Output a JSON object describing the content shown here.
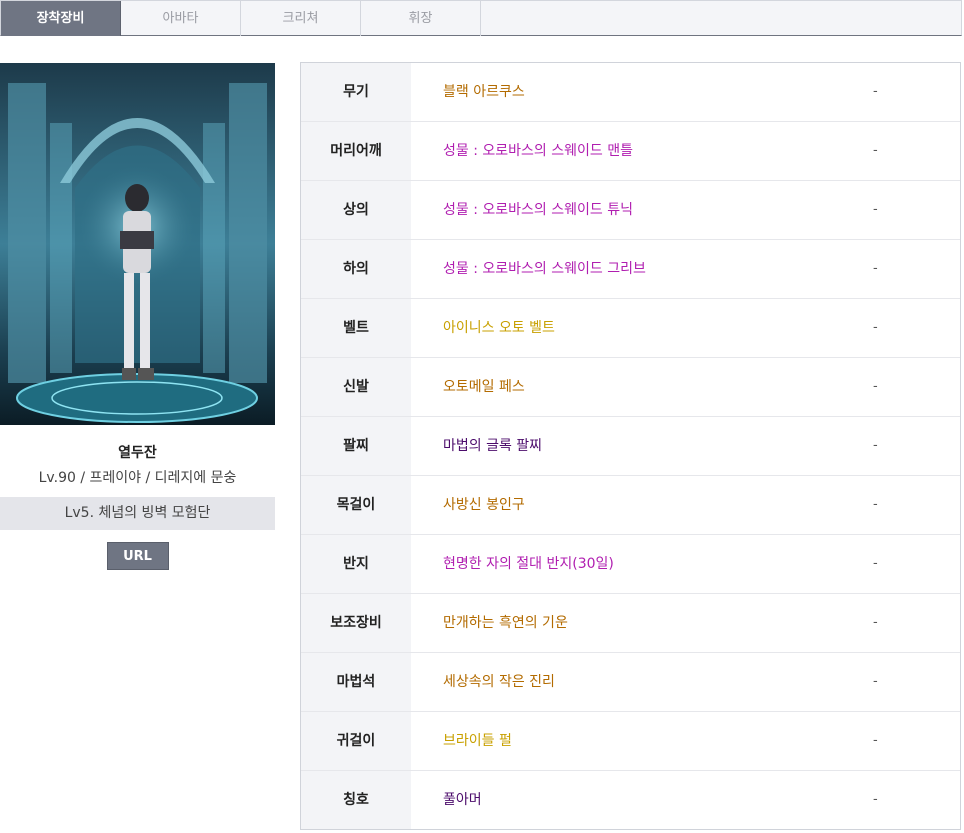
{
  "tabs": [
    {
      "label": "장착장비",
      "active": true
    },
    {
      "label": "아바타",
      "active": false
    },
    {
      "label": "크리쳐",
      "active": false
    },
    {
      "label": "휘장",
      "active": false
    }
  ],
  "profile": {
    "name": "열두잔",
    "info": "Lv.90 / 프레이야 / 디레지에 문숭",
    "guild": "Lv5. 체념의 빙벽 모험단",
    "url_button": "URL"
  },
  "equipment": [
    {
      "slot": "무기",
      "item": "블랙 아르쿠스",
      "color": "#b36b00",
      "extra": "-"
    },
    {
      "slot": "머리어깨",
      "item": "성물 : 오로바스의 스웨이드 맨틀",
      "color": "#b01eb0",
      "extra": "-"
    },
    {
      "slot": "상의",
      "item": "성물 : 오로바스의 스웨이드 튜닉",
      "color": "#b01eb0",
      "extra": "-"
    },
    {
      "slot": "하의",
      "item": "성물 : 오로바스의 스웨이드 그리브",
      "color": "#b01eb0",
      "extra": "-"
    },
    {
      "slot": "벨트",
      "item": "아이니스 오토 벨트",
      "color": "#c8a000",
      "extra": "-"
    },
    {
      "slot": "신발",
      "item": "오토메일 페스",
      "color": "#b36b00",
      "extra": "-"
    },
    {
      "slot": "팔찌",
      "item": "마법의 글록 팔찌",
      "color": "#4b0b6b",
      "extra": "-"
    },
    {
      "slot": "목걸이",
      "item": "사방신 봉인구",
      "color": "#b36b00",
      "extra": "-"
    },
    {
      "slot": "반지",
      "item": "현명한 자의 절대 반지(30일)",
      "color": "#b01eb0",
      "extra": "-"
    },
    {
      "slot": "보조장비",
      "item": "만개하는 흑연의 기운",
      "color": "#b36b00",
      "extra": "-"
    },
    {
      "slot": "마법석",
      "item": "세상속의 작은 진리",
      "color": "#b36b00",
      "extra": "-"
    },
    {
      "slot": "귀걸이",
      "item": "브라이들 펄",
      "color": "#c8a000",
      "extra": "-"
    },
    {
      "slot": "칭호",
      "item": "풀아머",
      "color": "#4b0b6b",
      "extra": "-"
    }
  ]
}
